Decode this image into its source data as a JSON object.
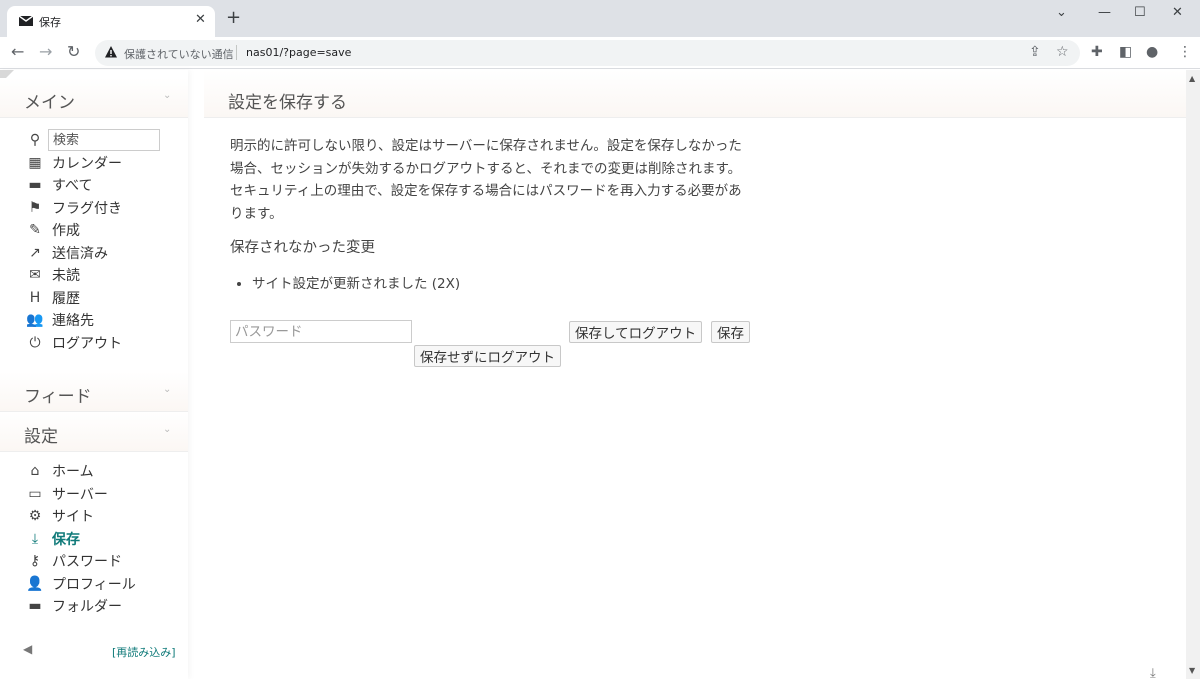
{
  "browser": {
    "tab_title": "保存",
    "tab_close": "✕",
    "new_tab": "+",
    "security_text": "保護されていない通信",
    "url": "nas01/?page=save"
  },
  "sidebar": {
    "main_title": "メイン",
    "search_placeholder": "検索",
    "main_items": [
      {
        "label": "カレンダー",
        "icon": "calendar-icon"
      },
      {
        "label": "すべて",
        "icon": "folder-icon"
      },
      {
        "label": "フラグ付き",
        "icon": "flag-icon"
      },
      {
        "label": "作成",
        "icon": "compose-icon"
      },
      {
        "label": "送信済み",
        "icon": "sent-icon"
      },
      {
        "label": "未読",
        "icon": "mail-icon"
      },
      {
        "label": "履歴",
        "icon": "history-icon"
      },
      {
        "label": "連絡先",
        "icon": "contacts-icon"
      },
      {
        "label": "ログアウト",
        "icon": "power-icon"
      }
    ],
    "feed_title": "フィード",
    "settings_title": "設定",
    "settings_items": [
      {
        "label": "ホーム",
        "icon": "home-icon"
      },
      {
        "label": "サーバー",
        "icon": "monitor-icon"
      },
      {
        "label": "サイト",
        "icon": "gear-icon"
      },
      {
        "label": "保存",
        "icon": "download-icon",
        "active": true
      },
      {
        "label": "パスワード",
        "icon": "key-icon"
      },
      {
        "label": "プロフィール",
        "icon": "user-icon"
      },
      {
        "label": "フォルダー",
        "icon": "folder-icon"
      }
    ],
    "reload_link": "[再読み込み]"
  },
  "content": {
    "title": "設定を保存する",
    "description": "明示的に許可しない限り、設定はサーバーに保存されません。設定を保存しなかった場合、セッションが失効するかログアウトすると、それまでの変更は削除されます。セキュリティ上の理由で、設定を保存する場合にはパスワードを再入力する必要があります。",
    "unsaved_heading": "保存されなかった変更",
    "changes": [
      "サイト設定が更新されました (2X)"
    ],
    "password_placeholder": "パスワード",
    "save_logout_label": "保存してログアウト",
    "save_label": "保存",
    "logout_nosave_label": "保存せずにログアウト"
  }
}
